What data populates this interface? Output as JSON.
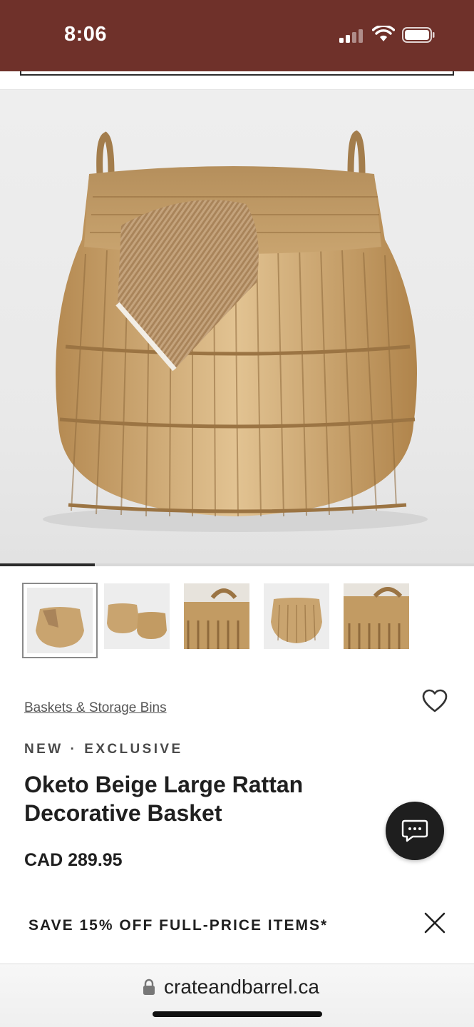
{
  "status_bar": {
    "time": "8:06",
    "signal_icon": "cellular-signal-icon",
    "wifi_icon": "wifi-icon",
    "battery_icon": "battery-icon",
    "background": "#6f312a"
  },
  "gallery": {
    "hero_alt": "Oketo Beige Large Rattan Decorative Basket",
    "image_count": 5,
    "selected_index": 0,
    "progress_fraction": 0.2,
    "thumbnails": [
      {
        "name": "thumbnail-basket-front"
      },
      {
        "name": "thumbnail-basket-pair"
      },
      {
        "name": "thumbnail-basket-handle-detail"
      },
      {
        "name": "thumbnail-basket-side"
      },
      {
        "name": "thumbnail-basket-weave-detail"
      }
    ]
  },
  "product": {
    "category": "Baskets & Storage Bins",
    "badge_new": "NEW",
    "badge_separator": "·",
    "badge_exclusive": "EXCLUSIVE",
    "title": "Oketo Beige Large Rattan Decorative Basket",
    "price": "CAD 289.95",
    "favorite_icon": "heart-icon",
    "chat_icon": "chat-bubble-icon"
  },
  "promo": {
    "text": "SAVE 15% OFF FULL-PRICE ITEMS*",
    "close_icon": "close-icon"
  },
  "browser": {
    "url": "crateandbarrel.ca",
    "lock_icon": "lock-icon"
  },
  "colors": {
    "brand": "#6f312a",
    "text": "#1f1f1f",
    "basket": "#c9a46f"
  }
}
